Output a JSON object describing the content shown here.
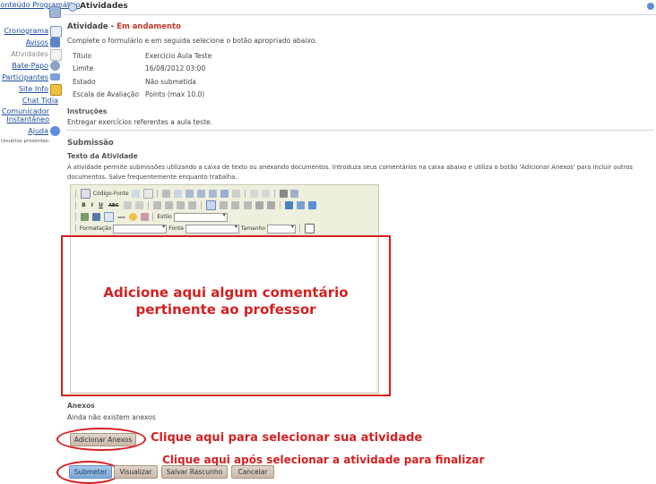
{
  "sidebar": {
    "items": [
      {
        "label": "Conteúdo Programático"
      },
      {
        "label": "Cronograma"
      },
      {
        "label": "Avisos"
      },
      {
        "label": "Atividades"
      },
      {
        "label": "Bate-Papo"
      },
      {
        "label": "Participantes"
      },
      {
        "label": "Site Info"
      },
      {
        "label": "Chat Tidia"
      },
      {
        "label": "Comunicador Instantâneo"
      },
      {
        "label": "Ajuda"
      }
    ],
    "present_label": "Usuários presentes:"
  },
  "header": {
    "title": "Atividades"
  },
  "assignment": {
    "heading_prefix": "Atividade - ",
    "heading_status": "Em andamento",
    "intro": "Complete o formulário e em seguida selecione o botão apropriado abaixo.",
    "fields": [
      {
        "label": "Título",
        "value": "Exercicio Aula Teste"
      },
      {
        "label": "Limite",
        "value": "16/08/2012 03:00"
      },
      {
        "label": "Estado",
        "value": "Não submetida"
      },
      {
        "label": "Escala de Avaliação",
        "value": "Points (max 10.0)"
      }
    ],
    "instructions_label": "Instruções",
    "instructions_text": "Entregar exercícios referentes a aula teste."
  },
  "submission": {
    "heading": "Submissão",
    "text_label": "Texto da Atividade",
    "help_line1": "A atividade permite submissões utilizando a caixa de texto ou anexando documentos. Introduza seus comentários na caixa abaixo e utiliza o botão 'Adicionar Anexos' para incluir outros",
    "help_line2": "documentos. Salve frequentemente enquanto trabalha."
  },
  "editor": {
    "source_label": "Código-Fonte",
    "style_label": "Estilo",
    "format_label": "Formatação",
    "font_label": "Fonte",
    "size_label": "Tamanho",
    "bold": "B",
    "italic": "I",
    "underline": "U",
    "strike": "ABC"
  },
  "annotations": {
    "editor_note_line1": "Adicione aqui algum comentário",
    "editor_note_line2": "pertinente ao professor",
    "attach_note": "Clique aqui para selecionar sua atividade",
    "submit_note": "Clique aqui após selecionar a atividade para finalizar"
  },
  "attachments": {
    "heading": "Anexos",
    "empty": "Ainda não existem anexos"
  },
  "buttons": {
    "add_attachments": "Adicionar Anexos",
    "submit": "Submeter",
    "preview": "Visualizar",
    "save_draft": "Salvar Rascunho",
    "cancel": "Cancelar"
  },
  "colors": {
    "accent_red": "#d42020",
    "link_blue": "#1a4e9c",
    "status_red": "#c0392b"
  },
  "icons": [
    "book-icon",
    "calendar-icon",
    "megaphone-icon",
    "document-icon",
    "chat-icon",
    "people-icon",
    "folder-icon",
    "help-icon",
    "gear-icon"
  ]
}
